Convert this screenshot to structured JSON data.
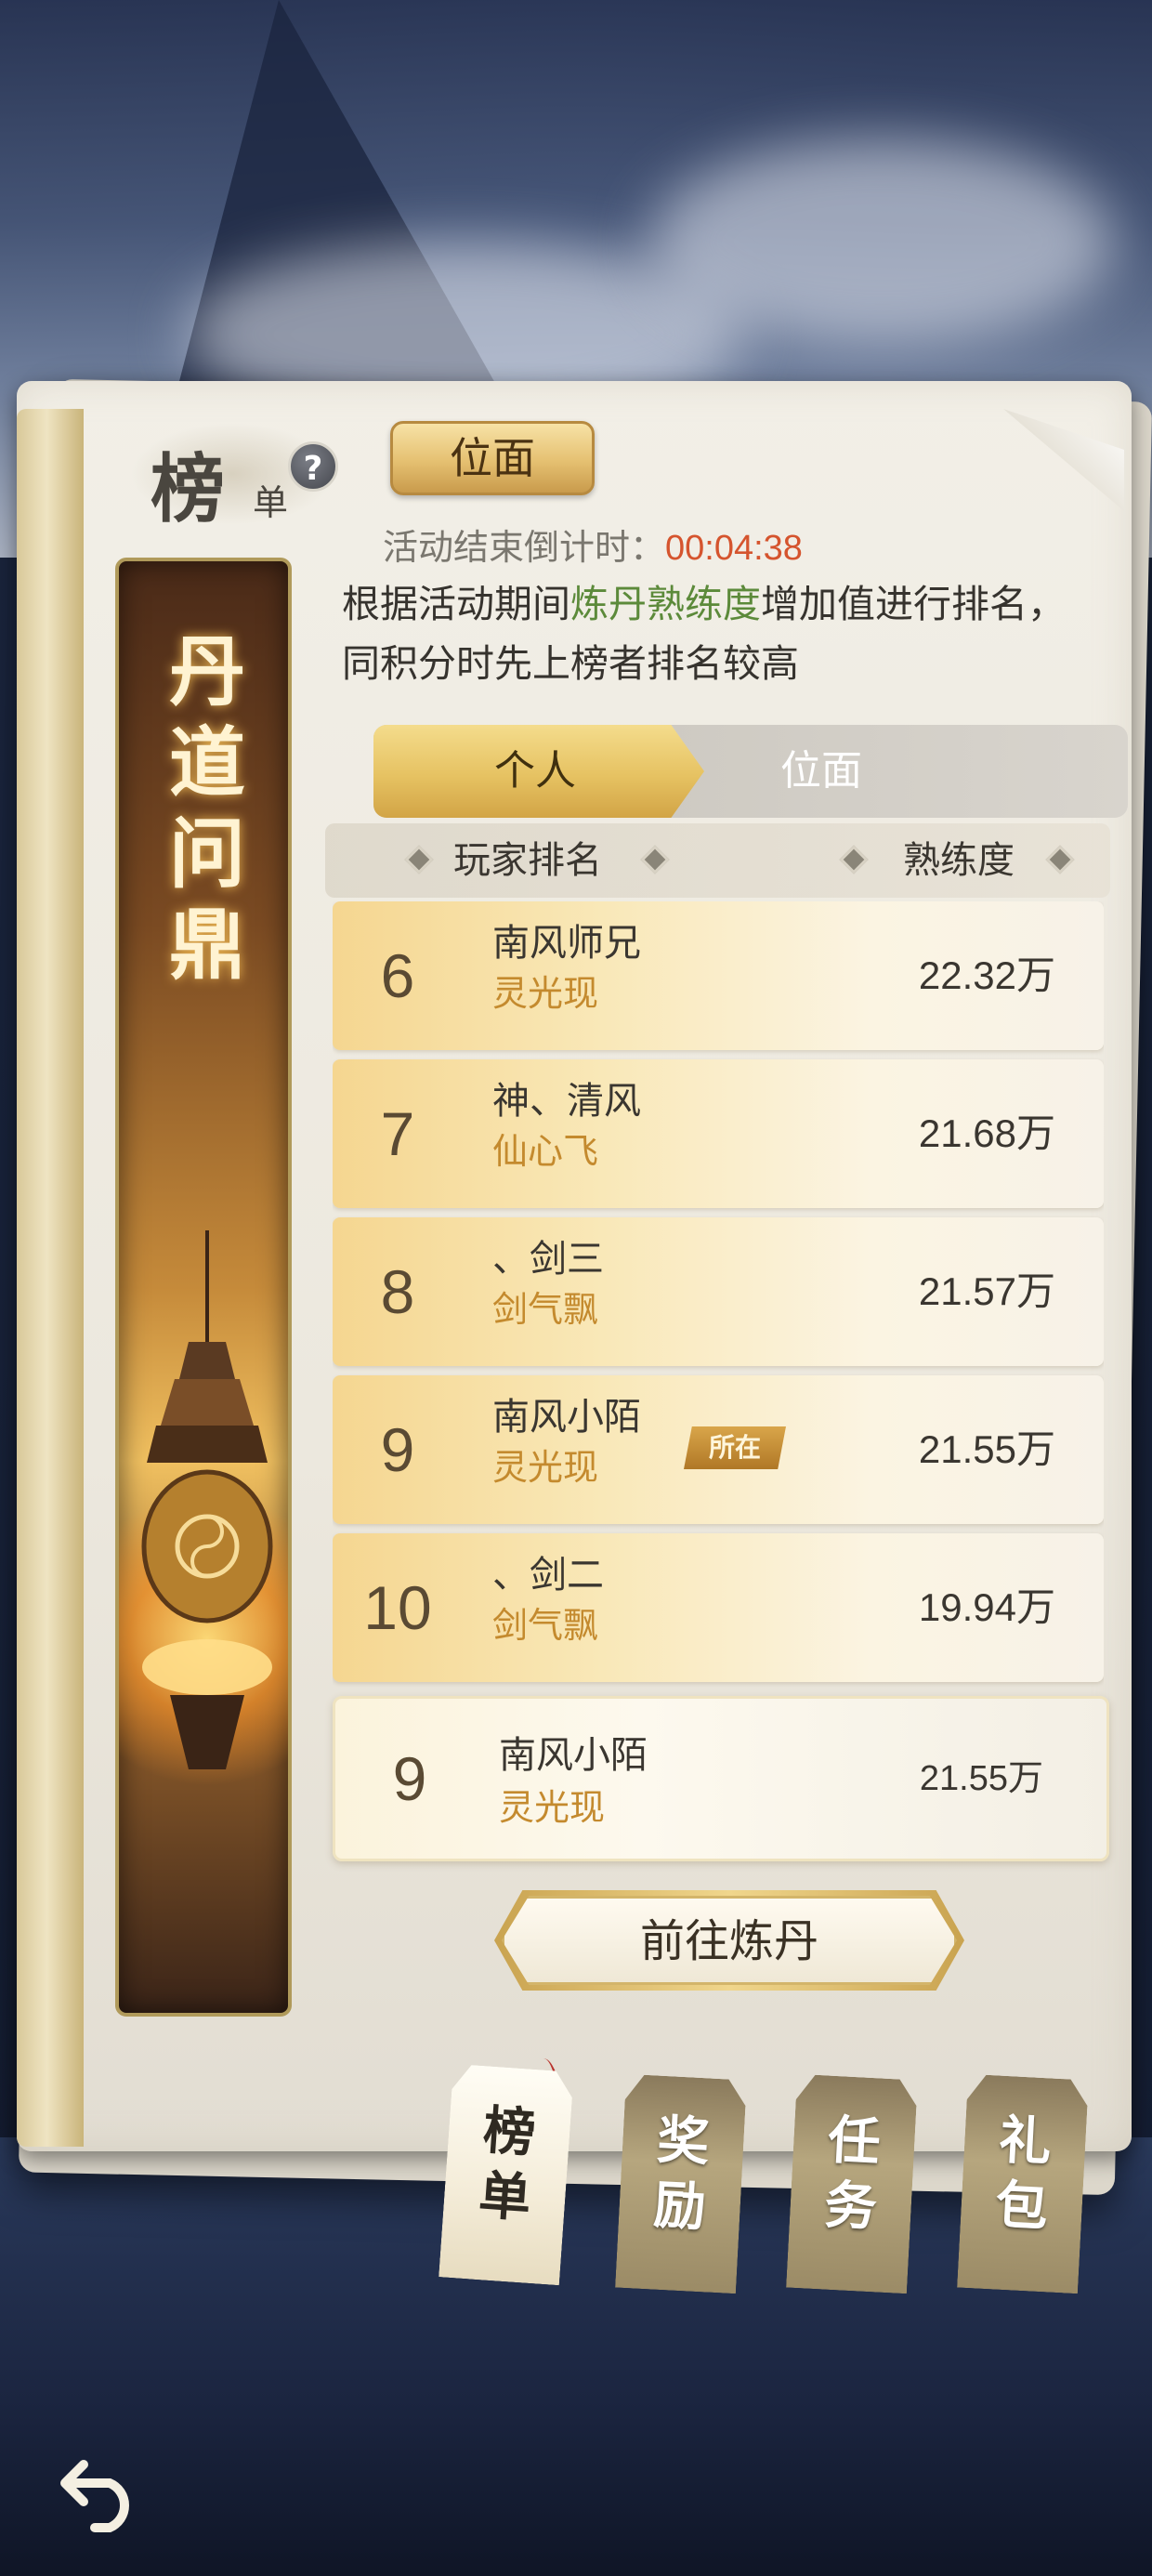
{
  "header": {
    "title_main": "榜",
    "title_sub": "单",
    "help_glyph": "?",
    "realm_button_label": "位面"
  },
  "event": {
    "countdown_label": "活动结束倒计时：",
    "countdown_value": "00:04:38",
    "desc_prefix": "根据活动期间",
    "desc_highlight": "炼丹熟练度",
    "desc_suffix": "增加值进行排名，同积分时先上榜者排名较高"
  },
  "banner": {
    "title_chars": [
      "丹",
      "道",
      "问",
      "鼎"
    ]
  },
  "tabs": {
    "personal": "个人",
    "realm": "位面"
  },
  "table": {
    "col_rank": "玩家排名",
    "col_score": "熟练度",
    "rows": [
      {
        "rank": "6",
        "name": "南风师兄",
        "tier": "灵光现",
        "score": "22.32万"
      },
      {
        "rank": "7",
        "name": "神、清风",
        "tier": "仙心飞",
        "score": "21.68万"
      },
      {
        "rank": "8",
        "name": "、剑三",
        "tier": "剑气飘",
        "score": "21.57万"
      },
      {
        "rank": "9",
        "name": "南风小陌",
        "tier": "灵光现",
        "score": "21.55万",
        "badge": "所在"
      },
      {
        "rank": "10",
        "name": "、剑二",
        "tier": "剑气飘",
        "score": "19.94万"
      }
    ]
  },
  "my_rank": {
    "rank": "9",
    "name": "南风小陌",
    "tier": "灵光现",
    "score": "21.55万"
  },
  "action": {
    "goto_label": "前往炼丹"
  },
  "bottom_tabs": [
    {
      "label_top": "榜",
      "label_bottom": "单",
      "active": true
    },
    {
      "label_top": "奖",
      "label_bottom": "励",
      "active": false
    },
    {
      "label_top": "任",
      "label_bottom": "务",
      "active": false
    },
    {
      "label_top": "礼",
      "label_bottom": "包",
      "active": false
    }
  ],
  "colors": {
    "accent_gold": "#e6c262",
    "highlight_green": "#5c8a3a",
    "countdown_red": "#d5542e",
    "tier_orange": "#c48a2e"
  },
  "icons": {
    "help": "question-circle-icon",
    "back": "back-arrow-icon"
  }
}
